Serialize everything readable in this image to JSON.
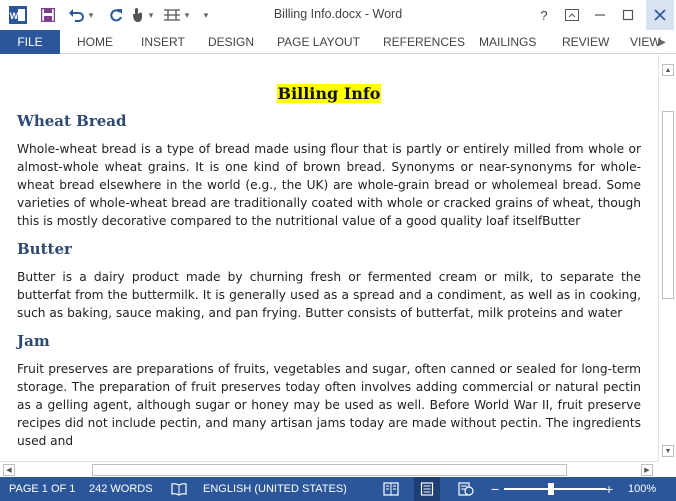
{
  "window": {
    "title": "Billing Info.docx - Word",
    "help": "?",
    "restore_ribbon": "⬒",
    "minimize": "—",
    "maximize": "☐",
    "close": "✕"
  },
  "quick_access": {
    "word_logo": "W",
    "save": "💾",
    "undo": "↶",
    "undo_dropdown": "▾",
    "redo": "↻",
    "touch_mode": "☝",
    "touch_dropdown": "▾",
    "table": "⊞",
    "table_dropdown": "▾",
    "customize": "▾"
  },
  "ribbon": {
    "tabs": [
      "FILE",
      "HOME",
      "INSERT",
      "DESIGN",
      "PAGE LAYOUT",
      "REFERENCES",
      "MAILINGS",
      "REVIEW",
      "VIEW"
    ],
    "scroll_right": "▶"
  },
  "document": {
    "title": "Billing Info",
    "sections": [
      {
        "heading": "Wheat Bread",
        "text": "Whole-wheat bread is a type of bread made using flour that is partly or entirely milled from whole or almost-whole wheat grains. It is one kind of brown bread. Synonyms or near-synonyms for whole-wheat bread elsewhere in the world (e.g., the UK) are whole-grain bread or wholemeal bread. Some varieties of whole-wheat bread are traditionally coated with whole or cracked grains of wheat, though this is mostly decorative compared to the nutritional value of a good quality loaf itselfButter"
      },
      {
        "heading": "Butter",
        "text": "Butter is a dairy product made by churning fresh or fermented cream or milk, to separate the butterfat from the buttermilk. It is generally used as a spread and a condiment, as well as in cooking, such as baking, sauce making, and pan frying. Butter consists of butterfat, milk proteins and water"
      },
      {
        "heading": "Jam",
        "text": "Fruit preserves are preparations of fruits, vegetables and sugar, often canned or sealed for long-term storage. The preparation of fruit preserves today often involves adding commercial or natural pectin as a gelling agent, although sugar or honey may be used as well. Before World War II, fruit preserve recipes did not include pectin, and many artisan jams today are made without pectin. The ingredients used and"
      }
    ]
  },
  "scrollbars": {
    "up": "▲",
    "down": "▼",
    "left": "◀",
    "right": "▶"
  },
  "status_bar": {
    "page": "PAGE 1 OF 1",
    "words": "242 WORDS",
    "proofing_icon": "📖",
    "language": "ENGLISH (UNITED STATES)",
    "zoom_out": "−",
    "zoom_in": "+",
    "zoom": "100%",
    "zoom_level": 1.0
  },
  "colors": {
    "accent": "#2b579a",
    "heading": "#2e4a72",
    "highlight": "#ffff00"
  }
}
